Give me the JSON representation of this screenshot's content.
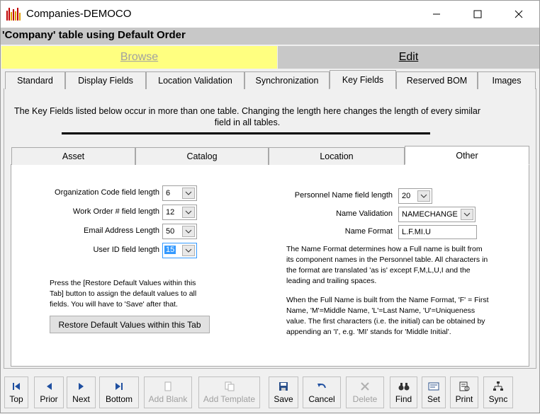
{
  "window": {
    "title": "Companies-DEMOCO"
  },
  "header": {
    "text": "'Company' table using Default Order"
  },
  "mode": {
    "browse_label": "Browse",
    "edit_label": "Edit"
  },
  "tabs": [
    {
      "label": "Standard"
    },
    {
      "label": "Display Fields"
    },
    {
      "label": "Location Validation"
    },
    {
      "label": "Synchronization"
    },
    {
      "label": "Key Fields"
    },
    {
      "label": "Reserved BOM"
    },
    {
      "label": "Images"
    }
  ],
  "info_text": "The Key Fields listed below occur in more than one table. Changing the length here changes the length of every similar field in all tables.",
  "subtabs": [
    {
      "label": "Asset"
    },
    {
      "label": "Catalog"
    },
    {
      "label": "Location"
    },
    {
      "label": "Other"
    }
  ],
  "fields": {
    "org_code": {
      "label": "Organization Code field length",
      "value": "6"
    },
    "work_order": {
      "label": "Work Order # field length",
      "value": "12"
    },
    "email": {
      "label": "Email Address Length",
      "value": "50"
    },
    "user_id": {
      "label": "User ID field length",
      "value": "15"
    },
    "personnel_name": {
      "label": "Personnel Name field length",
      "value": "20"
    },
    "name_validation": {
      "label": "Name Validation",
      "value": "NAMECHANGE"
    },
    "name_format": {
      "label": "Name Format",
      "value": "L.F.MI.U"
    }
  },
  "restore_note": "Press the [Restore Default Values within this Tab] button to assign the default values to all fields. You will have to 'Save' after that.",
  "restore_button": "Restore Default Values within this Tab",
  "name_format_help_1": "The Name Format determines how a Full name is built from its component names in the Personnel table. All characters in the format are translated 'as is' except F,M,L,U,I and the leading and trailing spaces.",
  "name_format_help_2": "When the Full Name is built from the Name Format, 'F' = First Name, 'M'=Middle Name, 'L'=Last Name, 'U'=Uniqueness value. The first characters (i.e. the initial) can be obtained by appending an 'I', e.g. 'MI' stands for 'Middle Initial'.",
  "toolbar": [
    {
      "label": "Top",
      "icon": "first-icon",
      "enabled": true
    },
    {
      "label": "Prior",
      "icon": "prior-icon",
      "enabled": true
    },
    {
      "label": "Next",
      "icon": "next-icon",
      "enabled": true
    },
    {
      "label": "Bottom",
      "icon": "last-icon",
      "enabled": true
    },
    {
      "label": "Add Blank",
      "icon": "add-blank-icon",
      "enabled": false
    },
    {
      "label": "Add Template",
      "icon": "add-template-icon",
      "enabled": false
    },
    {
      "label": "Save",
      "icon": "save-icon",
      "enabled": true
    },
    {
      "label": "Cancel",
      "icon": "undo-icon",
      "enabled": true
    },
    {
      "label": "Delete",
      "icon": "delete-icon",
      "enabled": false
    },
    {
      "label": "Find",
      "icon": "binoculars-icon",
      "enabled": true
    },
    {
      "label": "Set",
      "icon": "set-icon",
      "enabled": true
    },
    {
      "label": "Print",
      "icon": "print-icon",
      "enabled": true
    },
    {
      "label": "Sync",
      "icon": "sync-icon",
      "enabled": true
    }
  ],
  "colors": {
    "browse_bg": "#ffff80",
    "edit_bg": "#c8c8c8",
    "accent": "#3399ff"
  }
}
